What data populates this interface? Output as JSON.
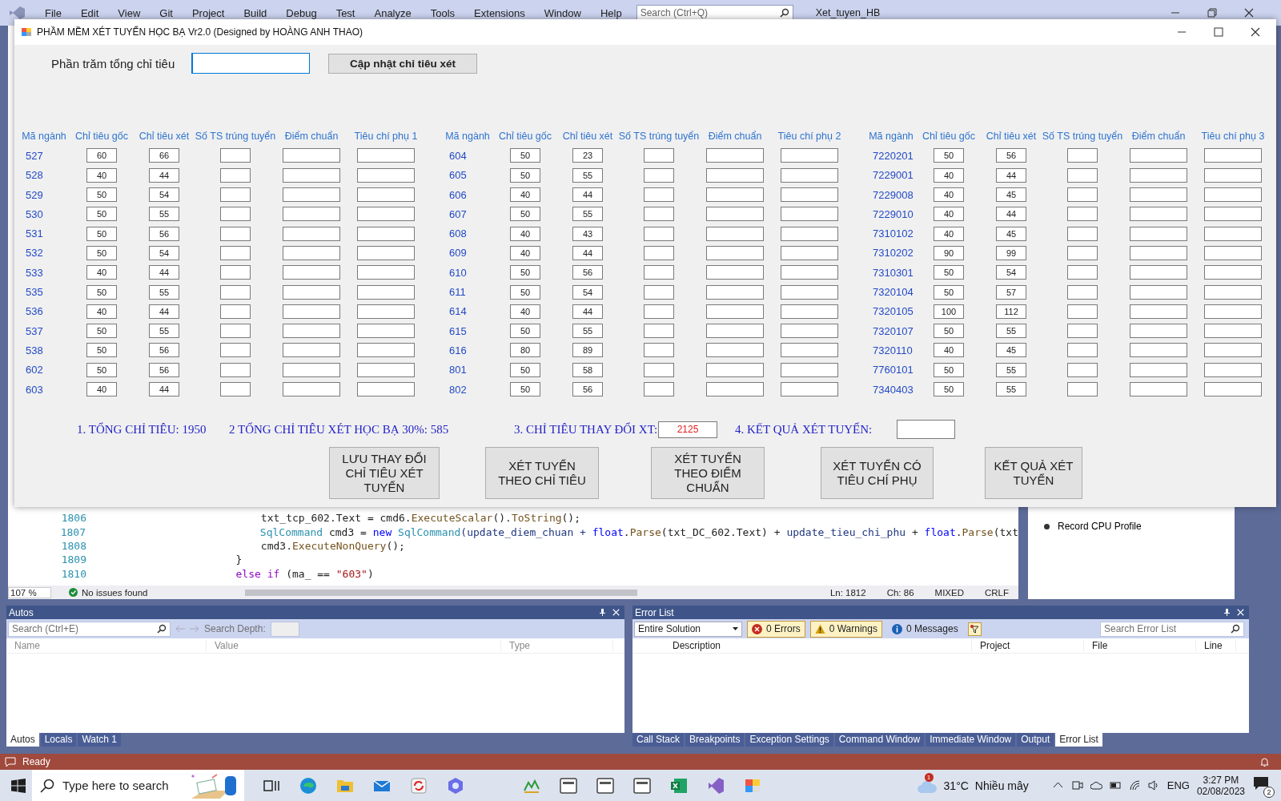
{
  "vs": {
    "menu": [
      "File",
      "Edit",
      "View",
      "Git",
      "Project",
      "Build",
      "Debug",
      "Test",
      "Analyze",
      "Tools",
      "Extensions",
      "Window",
      "Help"
    ],
    "search": {
      "placeholder": "Search (Ctrl+Q)"
    },
    "solution": "Xet_tuyen_HB"
  },
  "form": {
    "title": "PHẦM MỀM XÉT TUYỂN HỌC BẠ Vr2.0 (Designed by HOÀNG ANH THAO)",
    "percent_label": "Phần trăm tổng chỉ tiêu",
    "update_button": "Cập nhật chỉ tiêu xét",
    "groups": [
      {
        "headers": [
          "Mã ngành",
          "Chỉ tiêu gốc",
          "Chỉ tiêu xét",
          "Số TS trúng tuyển",
          "Điểm chuẩn",
          "Tiêu chí phụ 1"
        ],
        "rows": [
          {
            "code": "527",
            "base": "60",
            "quota": "66"
          },
          {
            "code": "528",
            "base": "40",
            "quota": "44"
          },
          {
            "code": "529",
            "base": "50",
            "quota": "54"
          },
          {
            "code": "530",
            "base": "50",
            "quota": "55"
          },
          {
            "code": "531",
            "base": "50",
            "quota": "56"
          },
          {
            "code": "532",
            "base": "50",
            "quota": "54"
          },
          {
            "code": "533",
            "base": "40",
            "quota": "44"
          },
          {
            "code": "535",
            "base": "50",
            "quota": "55"
          },
          {
            "code": "536",
            "base": "40",
            "quota": "44"
          },
          {
            "code": "537",
            "base": "50",
            "quota": "55"
          },
          {
            "code": "538",
            "base": "50",
            "quota": "56"
          },
          {
            "code": "602",
            "base": "50",
            "quota": "56"
          },
          {
            "code": "603",
            "base": "40",
            "quota": "44"
          }
        ]
      },
      {
        "headers": [
          "Mã ngành",
          "Chỉ tiêu gốc",
          "Chỉ tiêu xét",
          "Số TS trúng tuyển",
          "Điểm chuẩn",
          "Tiêu chí phụ 2"
        ],
        "rows": [
          {
            "code": "604",
            "base": "50",
            "quota": "23"
          },
          {
            "code": "605",
            "base": "50",
            "quota": "55"
          },
          {
            "code": "606",
            "base": "40",
            "quota": "44"
          },
          {
            "code": "607",
            "base": "50",
            "quota": "55"
          },
          {
            "code": "608",
            "base": "40",
            "quota": "43"
          },
          {
            "code": "609",
            "base": "40",
            "quota": "44"
          },
          {
            "code": "610",
            "base": "50",
            "quota": "56"
          },
          {
            "code": "611",
            "base": "50",
            "quota": "54"
          },
          {
            "code": "614",
            "base": "40",
            "quota": "44"
          },
          {
            "code": "615",
            "base": "50",
            "quota": "55"
          },
          {
            "code": "616",
            "base": "80",
            "quota": "89"
          },
          {
            "code": "801",
            "base": "50",
            "quota": "58"
          },
          {
            "code": "802",
            "base": "50",
            "quota": "56"
          }
        ]
      },
      {
        "headers": [
          "Mã ngành",
          "Chỉ tiêu gốc",
          "Chỉ tiêu xét",
          "Số TS trúng tuyển",
          "Điểm chuẩn",
          "Tiêu chí phụ 3"
        ],
        "rows": [
          {
            "code": "7220201",
            "base": "50",
            "quota": "56"
          },
          {
            "code": "7229001",
            "base": "40",
            "quota": "44"
          },
          {
            "code": "7229008",
            "base": "40",
            "quota": "45"
          },
          {
            "code": "7229010",
            "base": "40",
            "quota": "44"
          },
          {
            "code": "7310102",
            "base": "40",
            "quota": "45"
          },
          {
            "code": "7310202",
            "base": "90",
            "quota": "99"
          },
          {
            "code": "7310301",
            "base": "50",
            "quota": "54"
          },
          {
            "code": "7320104",
            "base": "50",
            "quota": "57"
          },
          {
            "code": "7320105",
            "base": "100",
            "quota": "112"
          },
          {
            "code": "7320107",
            "base": "50",
            "quota": "55"
          },
          {
            "code": "7320110",
            "base": "40",
            "quota": "45"
          },
          {
            "code": "7760101",
            "base": "50",
            "quota": "55"
          },
          {
            "code": "7340403",
            "base": "50",
            "quota": "55"
          }
        ]
      }
    ],
    "summary": {
      "total": "1. TỔNG CHỈ TIÊU: 1950",
      "hb_total": "2 TỔNG CHỈ TIÊU XÉT HỌC BẠ 30%:  585",
      "changed_label": "3. CHỈ TIÊU THAY ĐỔI XT:",
      "changed_value": "2125",
      "result_label": "4. KẾT QUẢ XÉT TUYỂN:"
    },
    "buttons": [
      "LƯU THAY ĐỔI CHỈ TIÊU XÉT TUYỂN",
      "XÉT TUYỂN THEO CHỈ TIÊU",
      "XÉT TUYỂN THEO ĐIỂM CHUẨN",
      "XÉT TUYỂN CÓ TIÊU CHÍ PHỤ",
      "KẾT QUẢ XÉT TUYỂN"
    ]
  },
  "editor": {
    "lines": [
      {
        "number": "1806",
        "tokens": [
          {
            "text": "                        txt_tcp_602.Text = cmd6.",
            "kind": "plain"
          },
          {
            "text": "ExecuteScalar",
            "kind": "method"
          },
          {
            "text": "().",
            "kind": "plain"
          },
          {
            "text": "ToString",
            "kind": "method"
          },
          {
            "text": "();",
            "kind": "plain"
          }
        ]
      },
      {
        "number": "1807",
        "tokens": [
          {
            "text": "                        SqlCommand",
            "kind": "type"
          },
          {
            "text": " cmd3 = ",
            "kind": "plain"
          },
          {
            "text": "new ",
            "kind": "keyword"
          },
          {
            "text": "SqlCommand",
            "kind": "type"
          },
          {
            "text": "(update_diem_chuan + ",
            "kind": "field"
          },
          {
            "text": "float",
            "kind": "keyword"
          },
          {
            "text": ".",
            "kind": "plain"
          },
          {
            "text": "Parse",
            "kind": "method"
          },
          {
            "text": "(txt_DC_602.Text) + ",
            "kind": "plain"
          },
          {
            "text": "update_tieu_chi_phu",
            "kind": "field"
          },
          {
            "text": " + ",
            "kind": "plain"
          },
          {
            "text": "float",
            "kind": "keyword"
          },
          {
            "text": ".",
            "kind": "plain"
          },
          {
            "text": "Parse",
            "kind": "method"
          },
          {
            "text": "(txt",
            "kind": "plain"
          }
        ]
      },
      {
        "number": "1808",
        "tokens": [
          {
            "text": "                        cmd3.",
            "kind": "plain"
          },
          {
            "text": "ExecuteNonQuery",
            "kind": "method"
          },
          {
            "text": "();",
            "kind": "plain"
          }
        ]
      },
      {
        "number": "1809",
        "tokens": [
          {
            "text": "                    }",
            "kind": "plain"
          }
        ]
      },
      {
        "number": "1810",
        "tokens": [
          {
            "text": "                    else if",
            "kind": "control"
          },
          {
            "text": " (ma_ == ",
            "kind": "plain"
          },
          {
            "text": "\"603\"",
            "kind": "string"
          },
          {
            "text": ")",
            "kind": "plain"
          }
        ]
      }
    ],
    "zoom": "107 %",
    "issues": "No issues found",
    "position": [
      "Ln: 1812",
      "Ch: 86",
      "MIXED",
      "CRLF"
    ]
  },
  "diagnostics": {
    "item": "Record CPU Profile"
  },
  "autos": {
    "title": "Autos",
    "search": {
      "placeholder": "Search (Ctrl+E)"
    },
    "depth_label": "Search Depth:",
    "columns": [
      "Name",
      "Value",
      "Type"
    ],
    "tabs": [
      {
        "label": "Autos",
        "selected": true
      },
      {
        "label": "Locals",
        "selected": false
      },
      {
        "label": "Watch 1",
        "selected": false
      }
    ]
  },
  "error_list": {
    "title": "Error List",
    "scope": "Entire Solution",
    "errors": "0 Errors",
    "warnings": "0 Warnings",
    "messages": "0 Messages",
    "search": {
      "placeholder": "Search Error List"
    },
    "columns": [
      "Description",
      "Project",
      "File",
      "Line"
    ],
    "tabs": [
      {
        "label": "Call Stack",
        "selected": false
      },
      {
        "label": "Breakpoints",
        "selected": false
      },
      {
        "label": "Exception Settings",
        "selected": false
      },
      {
        "label": "Command Window",
        "selected": false
      },
      {
        "label": "Immediate Window",
        "selected": false
      },
      {
        "label": "Output",
        "selected": false
      },
      {
        "label": "Error List",
        "selected": true
      }
    ]
  },
  "status": "Ready",
  "taskbar": {
    "search": {
      "placeholder": "Type here to search"
    },
    "weather_badge": "1",
    "temperature": "31°C",
    "weather": "Nhiều mây",
    "language": "ENG",
    "time": "3:27 PM",
    "date": "02/08/2023",
    "notifications": "2"
  }
}
